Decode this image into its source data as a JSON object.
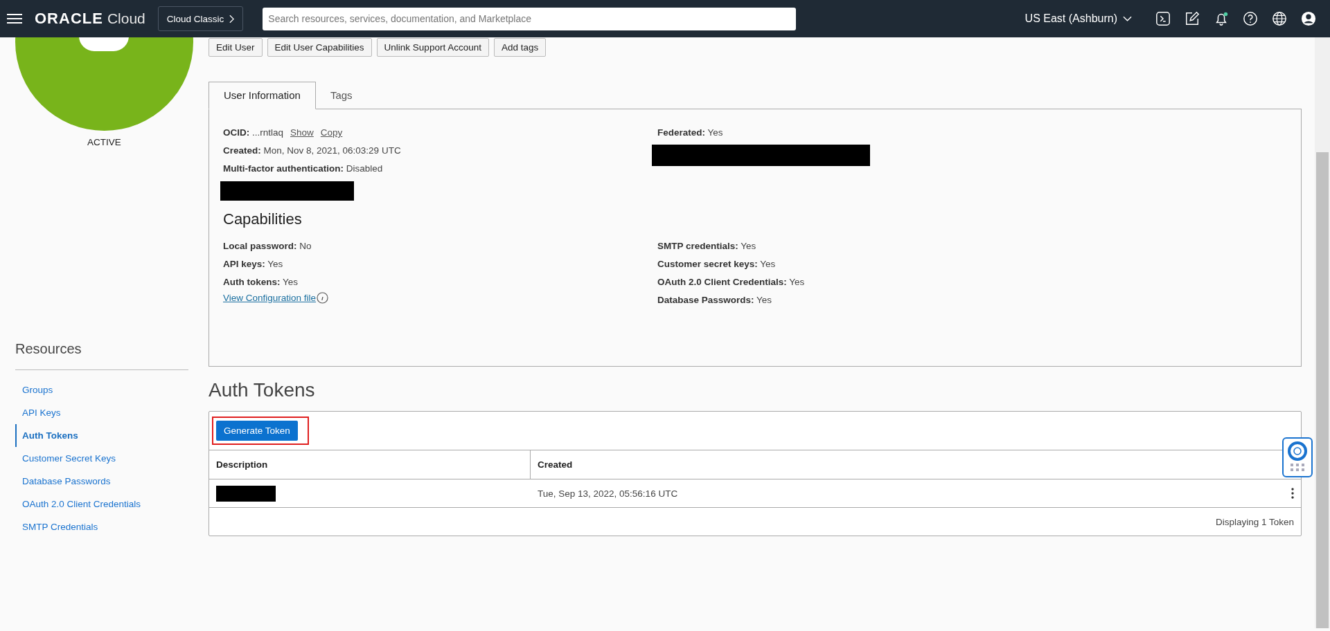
{
  "header": {
    "logo": "ORACLE",
    "product": "Cloud",
    "console_switch": "Cloud Classic",
    "search": {
      "placeholder": "Search resources, services, documentation, and Marketplace"
    },
    "region": "US East (Ashburn)"
  },
  "sidebar": {
    "status": "ACTIVE",
    "resources_title": "Resources",
    "items": [
      {
        "label": "Groups",
        "selected": false
      },
      {
        "label": "API Keys",
        "selected": false
      },
      {
        "label": "Auth Tokens",
        "selected": true
      },
      {
        "label": "Customer Secret Keys",
        "selected": false
      },
      {
        "label": "Database Passwords",
        "selected": false
      },
      {
        "label": "OAuth 2.0 Client Credentials",
        "selected": false
      },
      {
        "label": "SMTP Credentials",
        "selected": false
      }
    ]
  },
  "actions": [
    "Edit User",
    "Edit User Capabilities",
    "Unlink Support Account",
    "Add tags"
  ],
  "tabs": [
    {
      "label": "User Information",
      "selected": true
    },
    {
      "label": "Tags",
      "selected": false
    }
  ],
  "user_info": {
    "left": [
      {
        "text": "**OCID:** ...rntlaq",
        "links": [
          "Show",
          "Copy"
        ]
      },
      {
        "text": "**Created:** Mon, Nov 8, 2021, 06:03:29 UTC"
      },
      {
        "text": "**Multi-factor authentication:** Disabled"
      }
    ],
    "right": [
      {
        "text": "**Federated:** Yes"
      }
    ]
  },
  "capabilities": {
    "title": "Capabilities",
    "left": [
      "**Local password:** No",
      "**API keys:** Yes",
      "**Auth tokens:** Yes"
    ],
    "link": "View Configuration file",
    "right": [
      "**SMTP credentials:** Yes",
      "**Customer secret keys:** Yes",
      "**OAuth 2.0 Client Credentials:** Yes",
      "**Database Passwords:** Yes"
    ]
  },
  "auth_tokens": {
    "title": "Auth Tokens",
    "button": "Generate Token",
    "columns": [
      "Description",
      "Created"
    ],
    "rows": [
      {
        "created": "Tue, Sep 13, 2022, 05:56:16 UTC"
      }
    ],
    "footer": "Displaying 1 Token"
  }
}
